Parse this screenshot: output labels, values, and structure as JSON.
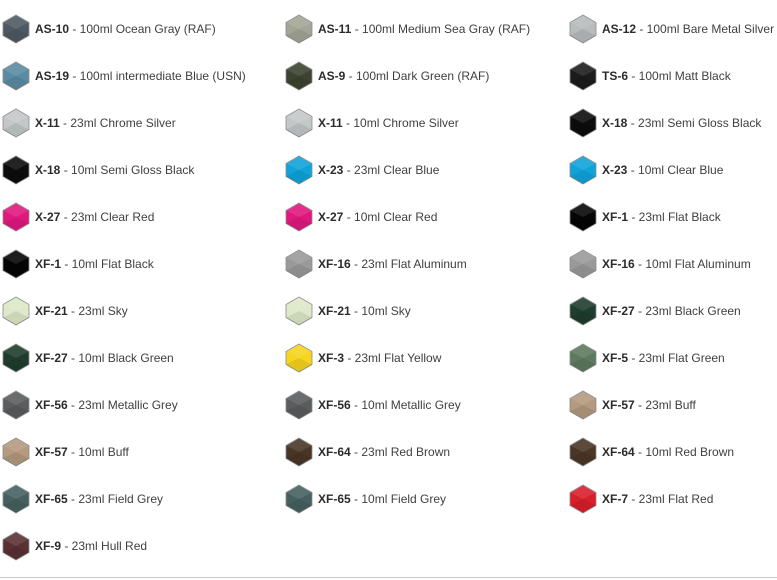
{
  "paints": [
    {
      "code": "AS-10",
      "desc": " - 100ml Ocean Gray (RAF)",
      "color": "#4e5a63"
    },
    {
      "code": "AS-11",
      "desc": " - 100ml Medium Sea Gray (RAF)",
      "color": "#a3a596"
    },
    {
      "code": "AS-12",
      "desc": " - 100ml Bare Metal Silver",
      "color": "#b8bcbd"
    },
    {
      "code": "AS-19",
      "desc": " - 100ml intermediate Blue (USN)",
      "color": "#5a8ba3"
    },
    {
      "code": "AS-9",
      "desc": " - 100ml Dark Green (RAF)",
      "color": "#3d4330"
    },
    {
      "code": "TS-6",
      "desc": " - 100ml Matt Black",
      "color": "#1c1c1c"
    },
    {
      "code": "X-11",
      "desc": " - 23ml Chrome Silver",
      "color": "#c4c7c8"
    },
    {
      "code": "X-11",
      "desc": " - 10ml Chrome Silver",
      "color": "#c4c7c8"
    },
    {
      "code": "X-18",
      "desc": " - 23ml Semi Gloss Black",
      "color": "#0c0c0c"
    },
    {
      "code": "X-18",
      "desc": " - 10ml Semi Gloss Black",
      "color": "#0c0c0c"
    },
    {
      "code": "X-23",
      "desc": " - 23ml Clear Blue",
      "color": "#0fa3da"
    },
    {
      "code": "X-23",
      "desc": " - 10ml Clear Blue",
      "color": "#0fa3da"
    },
    {
      "code": "X-27",
      "desc": " - 23ml Clear Red",
      "color": "#e0187e"
    },
    {
      "code": "X-27",
      "desc": " - 10ml Clear Red",
      "color": "#e0187e"
    },
    {
      "code": "XF-1",
      "desc": " - 23ml Flat Black",
      "color": "#050505"
    },
    {
      "code": "XF-1",
      "desc": " - 10ml Flat Black",
      "color": "#050505"
    },
    {
      "code": "XF-16",
      "desc": " - 23ml Flat Aluminum",
      "color": "#9a9a9a"
    },
    {
      "code": "XF-16",
      "desc": " - 10ml Flat Aluminum",
      "color": "#9a9a9a"
    },
    {
      "code": "XF-21",
      "desc": " - 23ml Sky",
      "color": "#dde9c8"
    },
    {
      "code": "XF-21",
      "desc": " - 10ml Sky",
      "color": "#dde9c8"
    },
    {
      "code": "XF-27",
      "desc": " - 23ml Black Green",
      "color": "#1f3d2e"
    },
    {
      "code": "XF-27",
      "desc": " - 10ml Black Green",
      "color": "#1f3d2e"
    },
    {
      "code": "XF-3",
      "desc": " - 23ml Flat Yellow",
      "color": "#f7d41e"
    },
    {
      "code": "XF-5",
      "desc": " - 23ml Flat Green",
      "color": "#5d7a5f"
    },
    {
      "code": "XF-56",
      "desc": " - 23ml Metallic Grey",
      "color": "#5a5c5e"
    },
    {
      "code": "XF-56",
      "desc": " - 10ml Metallic Grey",
      "color": "#5a5c5e"
    },
    {
      "code": "XF-57",
      "desc": " - 23ml Buff",
      "color": "#b49a7e"
    },
    {
      "code": "XF-57",
      "desc": " - 10ml Buff",
      "color": "#b49a7e"
    },
    {
      "code": "XF-64",
      "desc": " - 23ml Red Brown",
      "color": "#4a3626"
    },
    {
      "code": "XF-64",
      "desc": " - 10ml Red Brown",
      "color": "#4a3626"
    },
    {
      "code": "XF-65",
      "desc": " - 23ml Field Grey",
      "color": "#46605f"
    },
    {
      "code": "XF-65",
      "desc": " - 10ml Field Grey",
      "color": "#46605f"
    },
    {
      "code": "XF-7",
      "desc": " - 23ml Flat Red",
      "color": "#d81f2c"
    },
    {
      "code": "XF-9",
      "desc": " - 23ml Hull Red",
      "color": "#5b3033"
    }
  ]
}
